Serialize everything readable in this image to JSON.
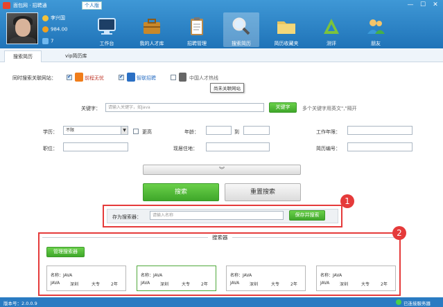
{
  "window": {
    "title": "面包网 · 招聘通",
    "role_badge": "个人版",
    "min": "—",
    "max": "☐",
    "close": "✕"
  },
  "user": {
    "name": "李兴国",
    "coins": "984.00",
    "count": "7"
  },
  "nav": [
    {
      "label": "工作台",
      "icon": "monitor-icon"
    },
    {
      "label": "我的人才库",
      "icon": "briefcase-icon"
    },
    {
      "label": "招聘管理",
      "icon": "clipboard-icon"
    },
    {
      "label": "搜索简历",
      "icon": "magnifier-icon"
    },
    {
      "label": "简历收藏夹",
      "icon": "folder-icon"
    },
    {
      "label": "测评",
      "icon": "ruler-icon"
    },
    {
      "label": "朋友",
      "icon": "friends-icon"
    }
  ],
  "tabs": [
    {
      "label": "搜索简历"
    },
    {
      "label": "vip简历库"
    }
  ],
  "sites": {
    "label": "同时搜索关联网站：",
    "items": [
      {
        "name": "前程无忧",
        "checked": true
      },
      {
        "name": "智联招聘",
        "checked": true
      },
      {
        "name": "中国人才热线",
        "checked": false
      }
    ],
    "tooltip": "尚未关联网站"
  },
  "keyword": {
    "label": "关键字：",
    "placeholder": "请输入关键字，如Java",
    "button": "关键字",
    "hint": "多个关键字用英文\",\"隔开"
  },
  "fields": {
    "education": {
      "label": "学历：",
      "value": "不限",
      "above": "更高"
    },
    "age": {
      "label": "年龄：",
      "to": "到"
    },
    "experience": {
      "label": "工作年限："
    },
    "position": {
      "label": "职位："
    },
    "location": {
      "label": "现居住地："
    },
    "resume_no": {
      "label": "简历编号："
    }
  },
  "expand_icon": "︾",
  "buttons": {
    "search": "搜索",
    "reset": "重置搜索"
  },
  "save": {
    "label": "存为搜索器：",
    "placeholder": "请输入名称",
    "button": "保存并搜索"
  },
  "annotations": [
    "1",
    "2"
  ],
  "searchers": {
    "title": "搜索器",
    "manage": "管理搜索器",
    "cards": [
      {
        "name": "名称：JAVA",
        "skill": "JAVA",
        "city": "深圳",
        "edu": "大专",
        "years": "2年",
        "selected": false
      },
      {
        "name": "名称：JAVA",
        "skill": "JAVA",
        "city": "深圳",
        "edu": "大专",
        "years": "2年",
        "selected": true
      },
      {
        "name": "名称：JAVA",
        "skill": "JAVA",
        "city": "深圳",
        "edu": "大专",
        "years": "2年",
        "selected": false
      },
      {
        "name": "名称：JAVA",
        "skill": "JAVA",
        "city": "深圳",
        "edu": "大专",
        "years": "2年",
        "selected": false
      }
    ]
  },
  "status": {
    "version": "版本号：2.0.0.9",
    "connection": "已连接服务器"
  },
  "colors": {
    "header": "#2a82c8",
    "green": "#4cb535",
    "annotation_red": "#e53a3a"
  }
}
